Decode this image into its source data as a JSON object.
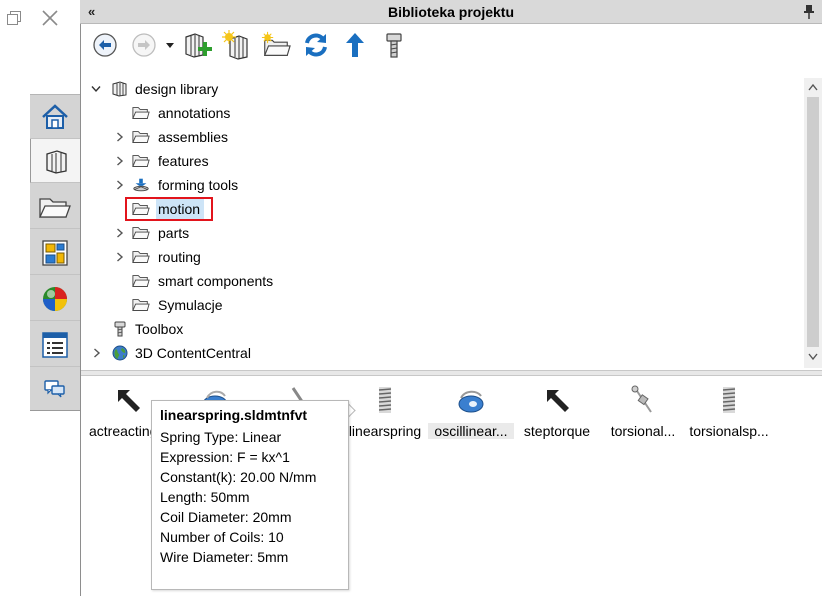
{
  "panel": {
    "title": "Biblioteka projektu",
    "collapse_glyph": "«"
  },
  "window_controls": [
    "restore-icon",
    "close-icon"
  ],
  "side_tabs": [
    {
      "icon": "home-icon",
      "active": false
    },
    {
      "icon": "design-library-icon",
      "active": true
    },
    {
      "icon": "file-explorer-icon",
      "active": false
    },
    {
      "icon": "view-palette-icon",
      "active": false
    },
    {
      "icon": "appearances-icon",
      "active": false
    },
    {
      "icon": "custom-properties-icon",
      "active": false
    },
    {
      "icon": "forum-icon",
      "active": false
    }
  ],
  "toolbar": [
    "back-icon",
    "forward-icon",
    "dropdown-icon",
    "add-to-library-icon",
    "add-file-location-icon",
    "create-new-folder-icon",
    "refresh-icon",
    "up-one-level-icon",
    "toolbox-icon"
  ],
  "tree": {
    "root": "design library",
    "children": [
      {
        "label": "annotations",
        "expandable": false
      },
      {
        "label": "assemblies",
        "expandable": true
      },
      {
        "label": "features",
        "expandable": true
      },
      {
        "label": "forming tools",
        "expandable": true
      },
      {
        "label": "motion",
        "expandable": false,
        "selected": true
      },
      {
        "label": "parts",
        "expandable": true
      },
      {
        "label": "routing",
        "expandable": true
      },
      {
        "label": "smart components",
        "expandable": false
      },
      {
        "label": "Symulacje",
        "expandable": false
      }
    ],
    "toolbox": "Toolbox",
    "content_central": "3D ContentCentral"
  },
  "items": [
    {
      "label": "actreacting",
      "icon": "arrow-icon"
    },
    {
      "label": "",
      "icon": "oscillating-icon"
    },
    {
      "label": "",
      "icon": "linear-spring-icon"
    },
    {
      "label": "linearspring",
      "icon": "spring-icon"
    },
    {
      "label": "oscillinear...",
      "icon": "oscillating-icon",
      "selected": true
    },
    {
      "label": "steptorque",
      "icon": "arrow-icon"
    },
    {
      "label": "torsional...",
      "icon": "torsional-icon"
    },
    {
      "label": "torsionalsp...",
      "icon": "spring-icon"
    }
  ],
  "tooltip": {
    "title": "linearspring.sldmtnfvt",
    "lines": [
      "Spring Type: Linear",
      "Expression: F = kx^1",
      "Constant(k): 20.00 N/mm",
      "Length: 50mm",
      "Coil Diameter: 20mm",
      "Number of Coils: 10",
      "Wire Diameter: 5mm"
    ]
  },
  "colors": {
    "highlight": "#e2141c",
    "selection": "#cde4f7",
    "accent": "#1a6fc0"
  }
}
